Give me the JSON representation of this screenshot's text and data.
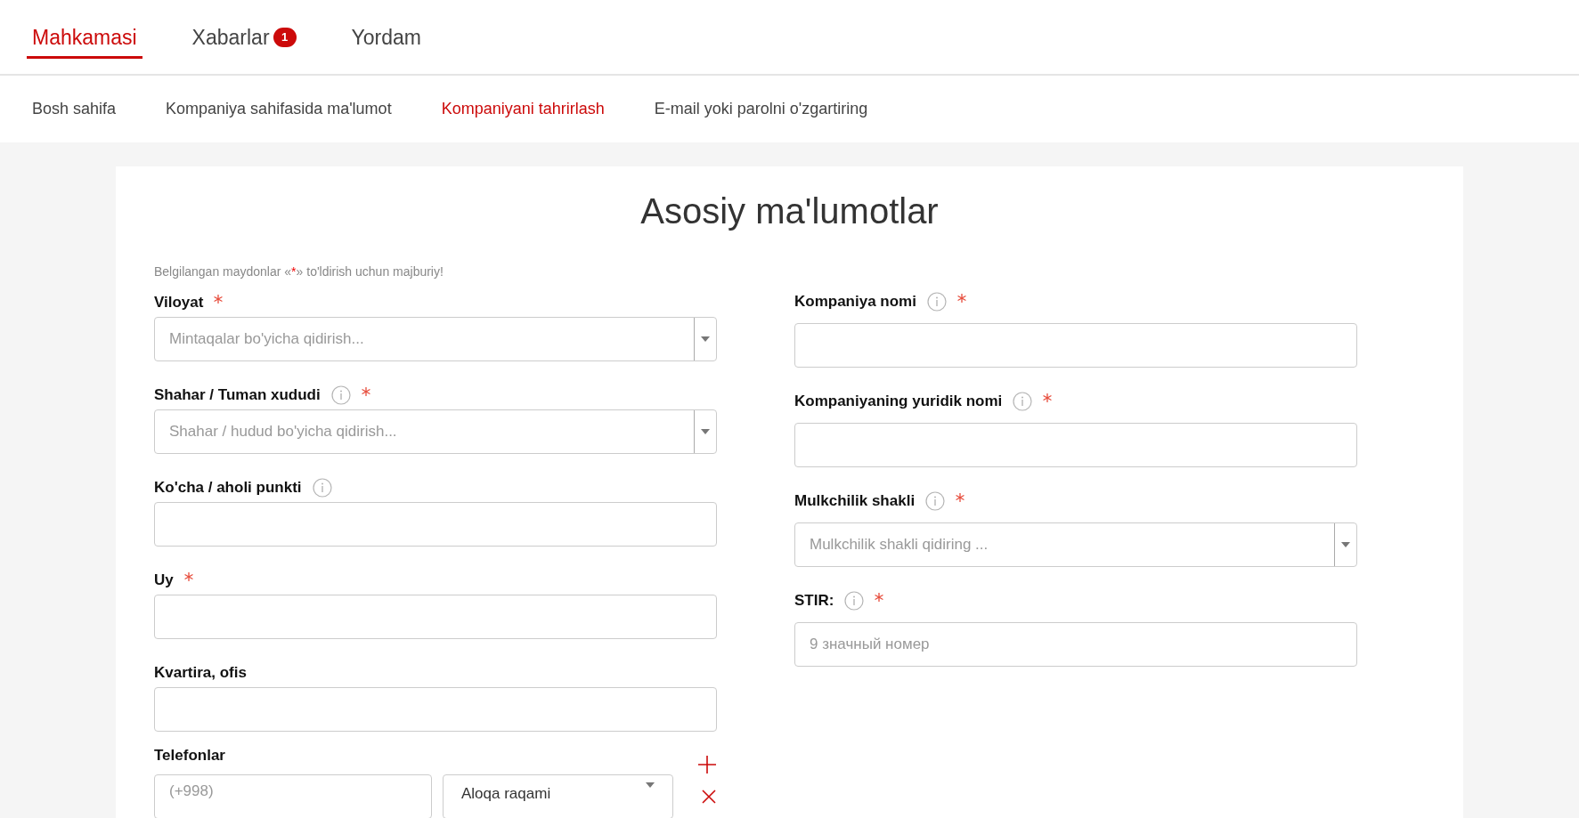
{
  "top_tabs": [
    {
      "label": "Mahkamasi",
      "selected": true
    },
    {
      "label": "Xabarlar",
      "selected": false,
      "badge": "1"
    },
    {
      "label": "Yordam",
      "selected": false
    }
  ],
  "sub_nav": [
    {
      "label": "Bosh sahifa",
      "selected": false
    },
    {
      "label": "Kompaniya sahifasida ma'lumot",
      "selected": false
    },
    {
      "label": "Kompaniyani tahrirlash",
      "selected": true
    },
    {
      "label": "E-mail yoki parolni o'zgartiring",
      "selected": false
    }
  ],
  "form": {
    "title": "Asosiy ma'lumotlar",
    "note": {
      "before": "Belgilangan maydonlar «",
      "mark": "*",
      "after": "» to'ldirish uchun majburiy!"
    },
    "left_fields": [
      {
        "kind": "select",
        "label": "Viloyat",
        "info": false,
        "required": true,
        "placeholder": "Mintaqalar bo'yicha qidirish..."
      },
      {
        "kind": "select",
        "label": "Shahar / Tuman xududi",
        "info": true,
        "required": true,
        "placeholder": "Shahar / hudud bo'yicha qidirish..."
      },
      {
        "kind": "input",
        "label": "Ko'cha / aholi punkti",
        "info": true,
        "required": false
      },
      {
        "kind": "input",
        "label": "Uy",
        "info": false,
        "required": true
      },
      {
        "kind": "input",
        "label": "Kvartira, ofis",
        "info": false,
        "required": false
      }
    ],
    "phones": {
      "label": "Telefonlar",
      "rows": [
        {
          "placeholder": "(+998)",
          "type": "Aloqa raqami"
        }
      ]
    },
    "right_fields": [
      {
        "kind": "input",
        "label": "Kompaniya nomi",
        "info": true,
        "required": true
      },
      {
        "kind": "input",
        "label": "Kompaniyaning yuridik nomi",
        "info": true,
        "required": true
      },
      {
        "kind": "select",
        "label": "Mulkchilik shakli",
        "info": true,
        "required": true,
        "placeholder": "Mulkchilik shakli qidiring ..."
      },
      {
        "kind": "input",
        "label": "STIR:",
        "info": true,
        "required": true,
        "placeholder": "9 значный номер"
      }
    ]
  }
}
